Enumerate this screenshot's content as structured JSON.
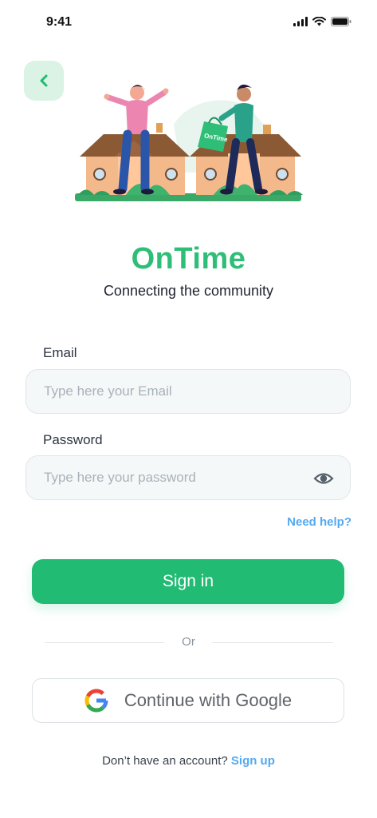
{
  "status_bar": {
    "time": "9:41"
  },
  "app": {
    "title": "OnTime",
    "tagline": "Connecting the community",
    "bag_text": "OnTime"
  },
  "form": {
    "email_label": "Email",
    "email_placeholder": "Type here your Email",
    "password_label": "Password",
    "password_placeholder": "Type here your password",
    "need_help": "Need help?"
  },
  "actions": {
    "signin_label": "Sign in",
    "or_text": "Or",
    "google_label": "Continue with Google"
  },
  "footer": {
    "prompt": "Don’t have an account?",
    "signup_label": "Sign up"
  },
  "colors": {
    "brand_green": "#22bb74",
    "link_blue": "#54a9f0",
    "back_bg": "#daf3e5"
  },
  "icons": [
    "back-chevron-icon",
    "signal-icon",
    "wifi-icon",
    "battery-icon",
    "eye-icon",
    "google-g-icon"
  ]
}
